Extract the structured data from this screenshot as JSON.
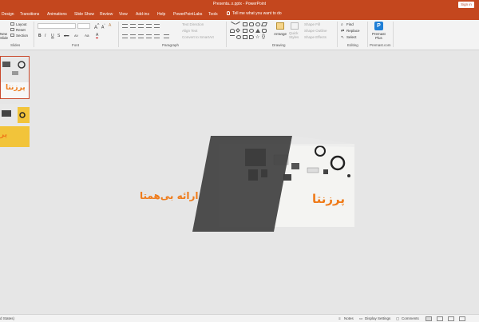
{
  "window": {
    "title": "Presenta..x.pptx  -  PowerPoint",
    "signin_label": "Sign in"
  },
  "tabs": [
    {
      "label": "Design"
    },
    {
      "label": "Transitions"
    },
    {
      "label": "Animations"
    },
    {
      "label": "Slide Show"
    },
    {
      "label": "Review"
    },
    {
      "label": "View"
    },
    {
      "label": "Add-ins"
    },
    {
      "label": "Help"
    },
    {
      "label": "PowerPointLabs"
    },
    {
      "label": "Tools"
    }
  ],
  "tell_me": "Tell me what you want to do",
  "ribbon": {
    "slides": {
      "new_label": "New\nSlide",
      "layout": "Layout",
      "reset": "Reset",
      "section": "Section",
      "group": "Slides"
    },
    "font": {
      "group": "Font",
      "bold": "B",
      "italic": "I",
      "underline": "U",
      "shadow": "S",
      "strike": "abc",
      "spacing": "AV",
      "case": "Aa",
      "color": "A"
    },
    "paragraph": {
      "text_direction": "Text Direction",
      "align_text": "Align Text",
      "convert_smartart": "Convert to SmartArt",
      "group": "Paragraph"
    },
    "drawing": {
      "arrange": "Arrange",
      "quick_styles": "Quick\nStyles",
      "shape_fill": "Shape Fill",
      "shape_outline": "Shape Outline",
      "shape_effects": "Shape Effects",
      "group": "Drawing"
    },
    "editing": {
      "find": "Find",
      "replace": "Replace",
      "select": "Select",
      "group": "Editing"
    },
    "premast": {
      "label": "Premast\nPlus",
      "group": "Premast.com"
    }
  },
  "slide": {
    "heading_left": "ارائه بی‌همتا",
    "heading_right": "پرزنتا"
  },
  "thumbnails": [
    {
      "text": "پرزنتا"
    },
    {
      "text": "پر"
    }
  ],
  "status": {
    "left": "d States)",
    "notes": "Notes",
    "display_settings": "Display Settings",
    "comments": "Comments"
  },
  "colors": {
    "accent": "#C4471E",
    "slide_orange": "#EF7B1A",
    "thumb_yellow": "#F2C43A"
  }
}
